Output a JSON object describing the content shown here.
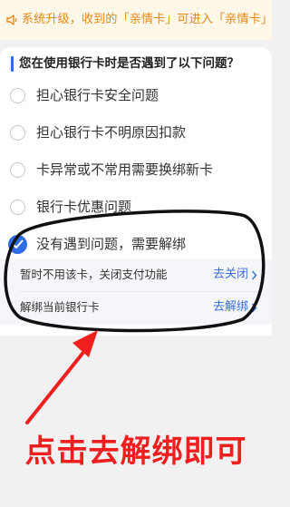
{
  "notice": {
    "icon": "speaker-icon",
    "text": "系统升级，收到的「亲情卡」可进入「亲情卡」"
  },
  "question": {
    "title": "您在使用银行卡时是否遇到了以下问题？"
  },
  "options": [
    {
      "label": "担心银行卡安全问题",
      "selected": false
    },
    {
      "label": "担心银行卡不明原因扣款",
      "selected": false
    },
    {
      "label": "卡异常或不常用需要换绑新卡",
      "selected": false
    },
    {
      "label": "银行卡优惠问题",
      "selected": false
    },
    {
      "label": "没有遇到问题，需要解绑",
      "selected": true
    }
  ],
  "sub_options": [
    {
      "label": "暂时不用该卡，关闭支付功能",
      "action": "去关闭"
    },
    {
      "label": "解绑当前银行卡",
      "action": "去解绑"
    }
  ],
  "caption": "点击去解绑即可",
  "colors": {
    "accent": "#2f6de6",
    "notice_text": "#e58a1a",
    "annotation_red": "#ef1f1f"
  }
}
